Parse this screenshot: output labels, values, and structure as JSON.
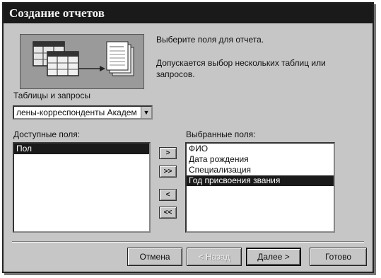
{
  "window": {
    "title": "Создание отчетов"
  },
  "intro": {
    "line1": "Выберите поля для отчета.",
    "line2": "Допускается выбор нескольких таблиц или",
    "line3": "запросов."
  },
  "tables": {
    "label": "Таблицы и запросы",
    "selected": "лены-корреспонденты Академ"
  },
  "available": {
    "label": "Доступные поля:",
    "items": [
      "Пол"
    ]
  },
  "selected": {
    "label": "Выбранные поля:",
    "items": [
      "ФИО",
      "Дата рождения",
      "Специализация",
      "Год присвоения звания"
    ]
  },
  "move_buttons": {
    "add": ">",
    "add_all": ">>",
    "remove": "<",
    "remove_all": "<<"
  },
  "buttons": {
    "cancel": "Отмена",
    "back": "< Назад",
    "next": "Далее >",
    "finish": "Готово"
  }
}
